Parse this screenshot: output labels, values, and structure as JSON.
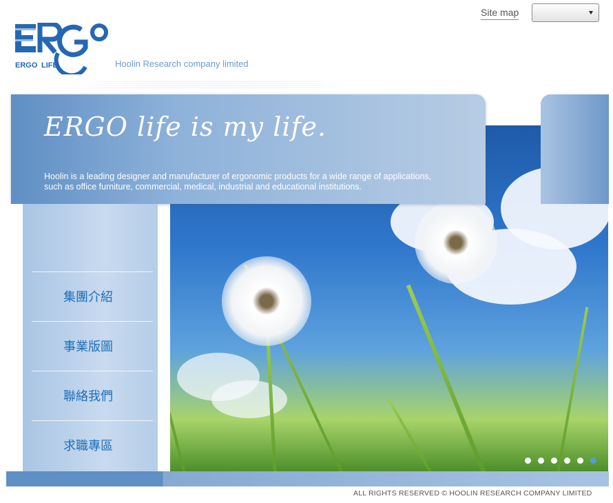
{
  "header": {
    "sitemap_label": "Site map",
    "language_select_value": "",
    "tagline": "Hoolin Research company limited"
  },
  "logo": {
    "word": "ERGO",
    "sub_left": "ERGO",
    "sub_right": "LIFE",
    "brand_color": "#2467b3"
  },
  "banner": {
    "title": "ERGO life is my life.",
    "description_line1": "Hoolin is a leading designer and manufacturer of ergonomic products for a wide range of applications,",
    "description_line2": "such as office furniture, commercial, medical, industrial and educational institutions."
  },
  "menu": {
    "items": [
      {
        "label": "集團介紹"
      },
      {
        "label": "事業版圖"
      },
      {
        "label": "聯絡我們"
      },
      {
        "label": "求職專區"
      }
    ]
  },
  "slideshow": {
    "total_slides": 6,
    "active_index": 5,
    "image_subject": "dandelion-field-icon"
  },
  "footer": {
    "copyright": "ALL RIGHTS RESERVED © HOOLIN RESEARCH COMPANY LIMITED"
  },
  "colors": {
    "accent": "#1f6fba",
    "banner_blue": "#5f8fc4",
    "menu_bg": "#c8daef"
  }
}
